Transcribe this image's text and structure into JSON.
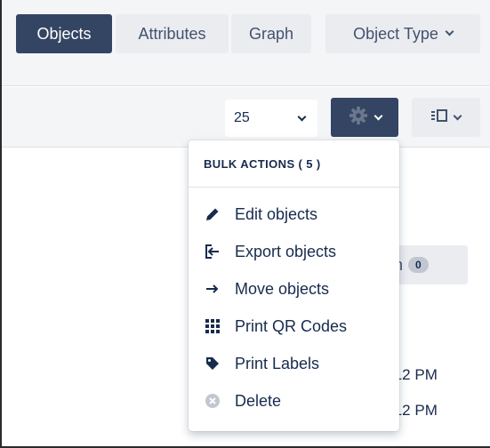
{
  "tabs": {
    "objects": "Objects",
    "attributes": "Attributes",
    "graph": "Graph",
    "object_type": "Object Type"
  },
  "toolbar": {
    "page_size": "25",
    "settings_icon": "gear-icon",
    "view_icon": "column-list-icon"
  },
  "background": {
    "search_label_partial": "ch",
    "search_count": "0",
    "times": [
      ":12 PM",
      ":12 PM"
    ]
  },
  "bulk_menu": {
    "header": "BULK ACTIONS ( 5 )",
    "items": [
      {
        "label": "Edit objects",
        "icon": "pencil-icon"
      },
      {
        "label": "Export objects",
        "icon": "export-icon"
      },
      {
        "label": "Move objects",
        "icon": "arrow-right-icon"
      },
      {
        "label": "Print QR Codes",
        "icon": "grid-dots-icon"
      },
      {
        "label": "Print Labels",
        "icon": "tag-icon"
      },
      {
        "label": "Delete",
        "icon": "remove-circle-icon"
      }
    ]
  },
  "colors": {
    "primary_dark": "#344563",
    "tab_bg": "#ebecf0",
    "toolbar_bg": "#f4f5f7",
    "text": "#172b4d"
  }
}
